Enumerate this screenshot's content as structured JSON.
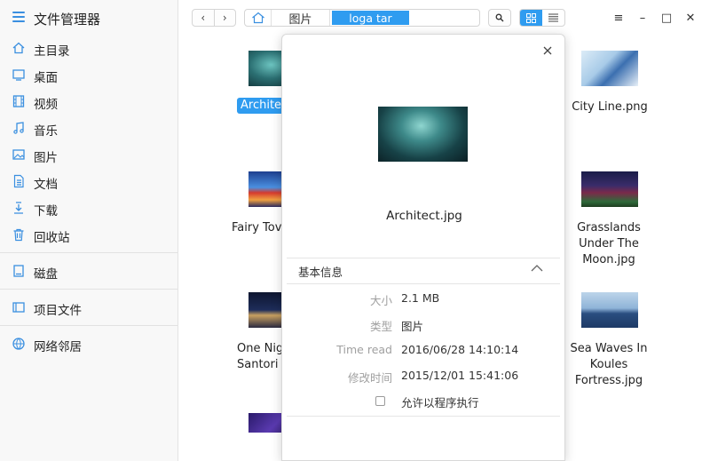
{
  "app": {
    "title": "文件管理器",
    "menu_icon": "hamburger-icon"
  },
  "sidebar": {
    "items": [
      {
        "label": "主目录",
        "icon": "home-icon"
      },
      {
        "label": "桌面",
        "icon": "desktop-icon"
      },
      {
        "label": "视频",
        "icon": "video-icon"
      },
      {
        "label": "音乐",
        "icon": "music-icon"
      },
      {
        "label": "图片",
        "icon": "picture-icon"
      },
      {
        "label": "文档",
        "icon": "document-icon"
      },
      {
        "label": "下载",
        "icon": "download-icon"
      },
      {
        "label": "回收站",
        "icon": "trash-icon"
      }
    ],
    "disk": {
      "label": "磁盘",
      "icon": "disk-icon"
    },
    "project": {
      "label": "项目文件",
      "icon": "project-icon"
    },
    "network": {
      "label": "网络邻居",
      "icon": "network-icon"
    }
  },
  "toolbar": {
    "back": "‹",
    "forward": "›",
    "breadcrumb": {
      "home_icon": "home-icon",
      "current": "图片",
      "input_value": "loga tar"
    },
    "window": {
      "menu": "≡",
      "minimize": "–",
      "maximize": "□",
      "close": "✕"
    }
  },
  "files": {
    "row1_left": "Architec",
    "row1_right": "City Line.png",
    "row2_left": "Fairy Tov",
    "row2_right": [
      "Grasslands",
      "Under The",
      "Moon.jpg"
    ],
    "row3_left": [
      "One Nig",
      "Santori"
    ],
    "row3_right": [
      "Sea Waves In",
      "Koules",
      "Fortress.jpg"
    ]
  },
  "dialog": {
    "file_name": "Architect.jpg",
    "section_title": "基本信息",
    "info": [
      {
        "key": "大小",
        "value": "2.1 MB"
      },
      {
        "key": "类型",
        "value": "图片"
      },
      {
        "key": "Time read",
        "value": "2016/06/28 14:10:14"
      },
      {
        "key": "修改时间",
        "value": "2015/12/01 15:41:06"
      }
    ],
    "executable_label": "允许以程序执行",
    "executable_checked": false
  },
  "colors": {
    "accent": "#2f9cf0",
    "sidebar_icon": "#3a8fe0"
  }
}
